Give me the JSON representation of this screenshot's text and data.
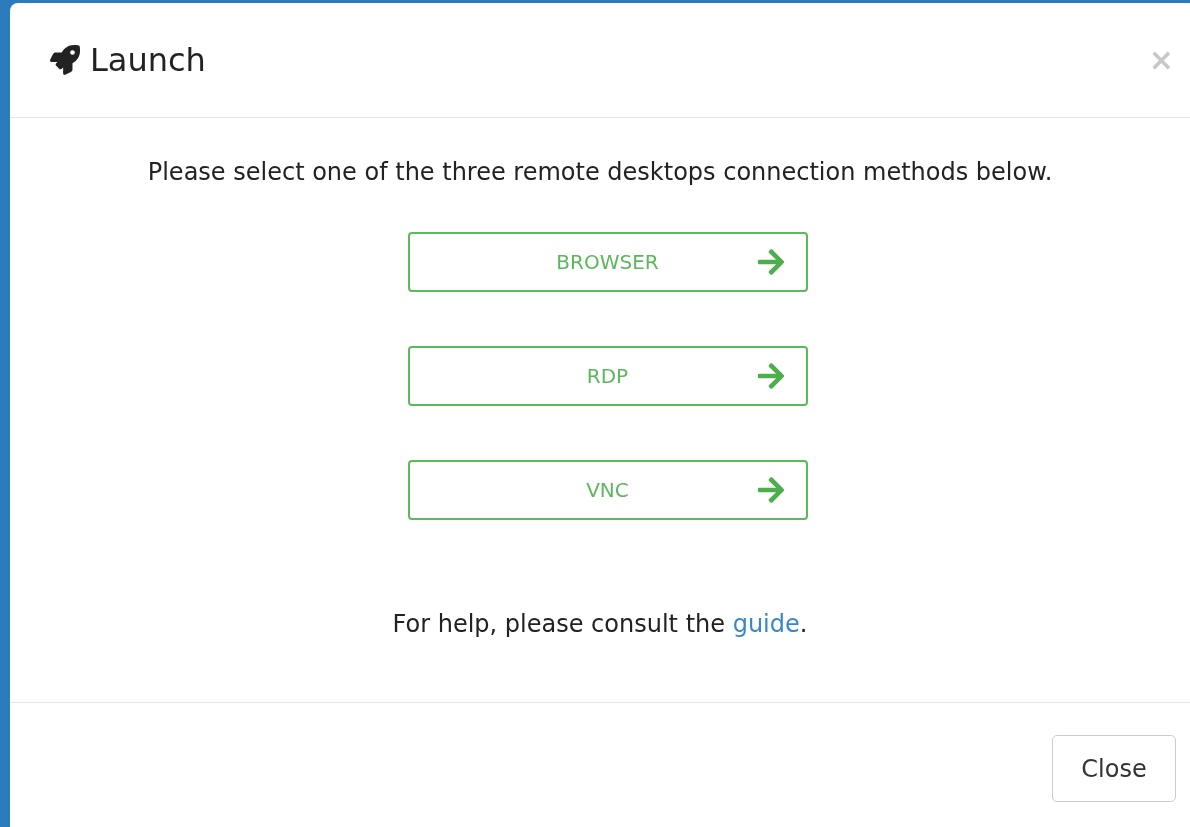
{
  "dialog": {
    "title": "Launch",
    "close_glyph": "×"
  },
  "intro": "Please select one of the three remote desktops connection methods below.",
  "methods": [
    {
      "label": "BROWSER"
    },
    {
      "label": "RDP"
    },
    {
      "label": "VNC"
    }
  ],
  "help": {
    "prefix": "For help, please consult the",
    "link": "guide",
    "suffix": "."
  },
  "footer_buttons": [
    "Close"
  ]
}
